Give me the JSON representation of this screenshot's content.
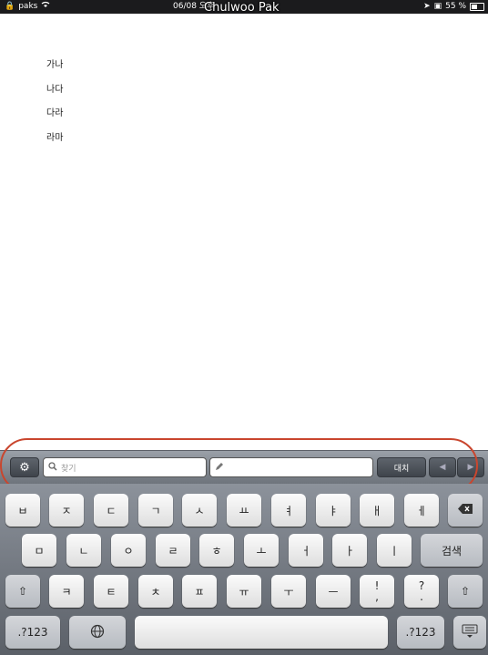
{
  "status_bar": {
    "carrier": "paks",
    "datetime": "06/08 오후",
    "user": "Chulwoo Pak",
    "battery": "55 %"
  },
  "overlay_title": "Chulwoo Pak",
  "document": {
    "lines": [
      "가나",
      "나다",
      "다라",
      "라마"
    ]
  },
  "toolbar": {
    "search_placeholder": "찾기",
    "replace_placeholder": "",
    "replace_button": "대치"
  },
  "keyboard": {
    "row1": [
      "ㅂ",
      "ㅈ",
      "ㄷ",
      "ㄱ",
      "ㅅ",
      "ㅛ",
      "ㅕ",
      "ㅑ",
      "ㅐ",
      "ㅔ"
    ],
    "row2": [
      "ㅁ",
      "ㄴ",
      "ㅇ",
      "ㄹ",
      "ㅎ",
      "ㅗ",
      "ㅓ",
      "ㅏ",
      "ㅣ"
    ],
    "row2_action": "검색",
    "row3": [
      "ㅋ",
      "ㅌ",
      "ㅊ",
      "ㅍ",
      "ㅠ",
      "ㅜ",
      "ㅡ"
    ],
    "row3_punct": [
      "!\n,",
      "?\n."
    ],
    "num_key": ".?123",
    "colors": {
      "accent_oval": "#c9462e",
      "toolbar": "#7f858d"
    }
  }
}
